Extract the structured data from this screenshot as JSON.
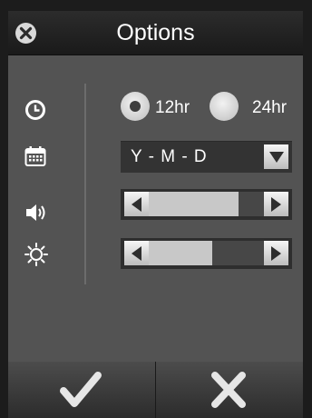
{
  "window": {
    "title": "Options"
  },
  "time_format": {
    "options": [
      {
        "label": "12hr",
        "selected": true
      },
      {
        "label": "24hr",
        "selected": false
      }
    ]
  },
  "date_format": {
    "value": "Y - M - D"
  },
  "volume": {
    "level": 0.78
  },
  "brightness": {
    "level": 0.55
  },
  "icons": {
    "close": "close-icon",
    "time": "clock-icon",
    "date": "calendar-icon",
    "volume": "speaker-icon",
    "brightness": "sun-icon",
    "confirm": "checkmark-icon",
    "cancel": "x-icon"
  }
}
